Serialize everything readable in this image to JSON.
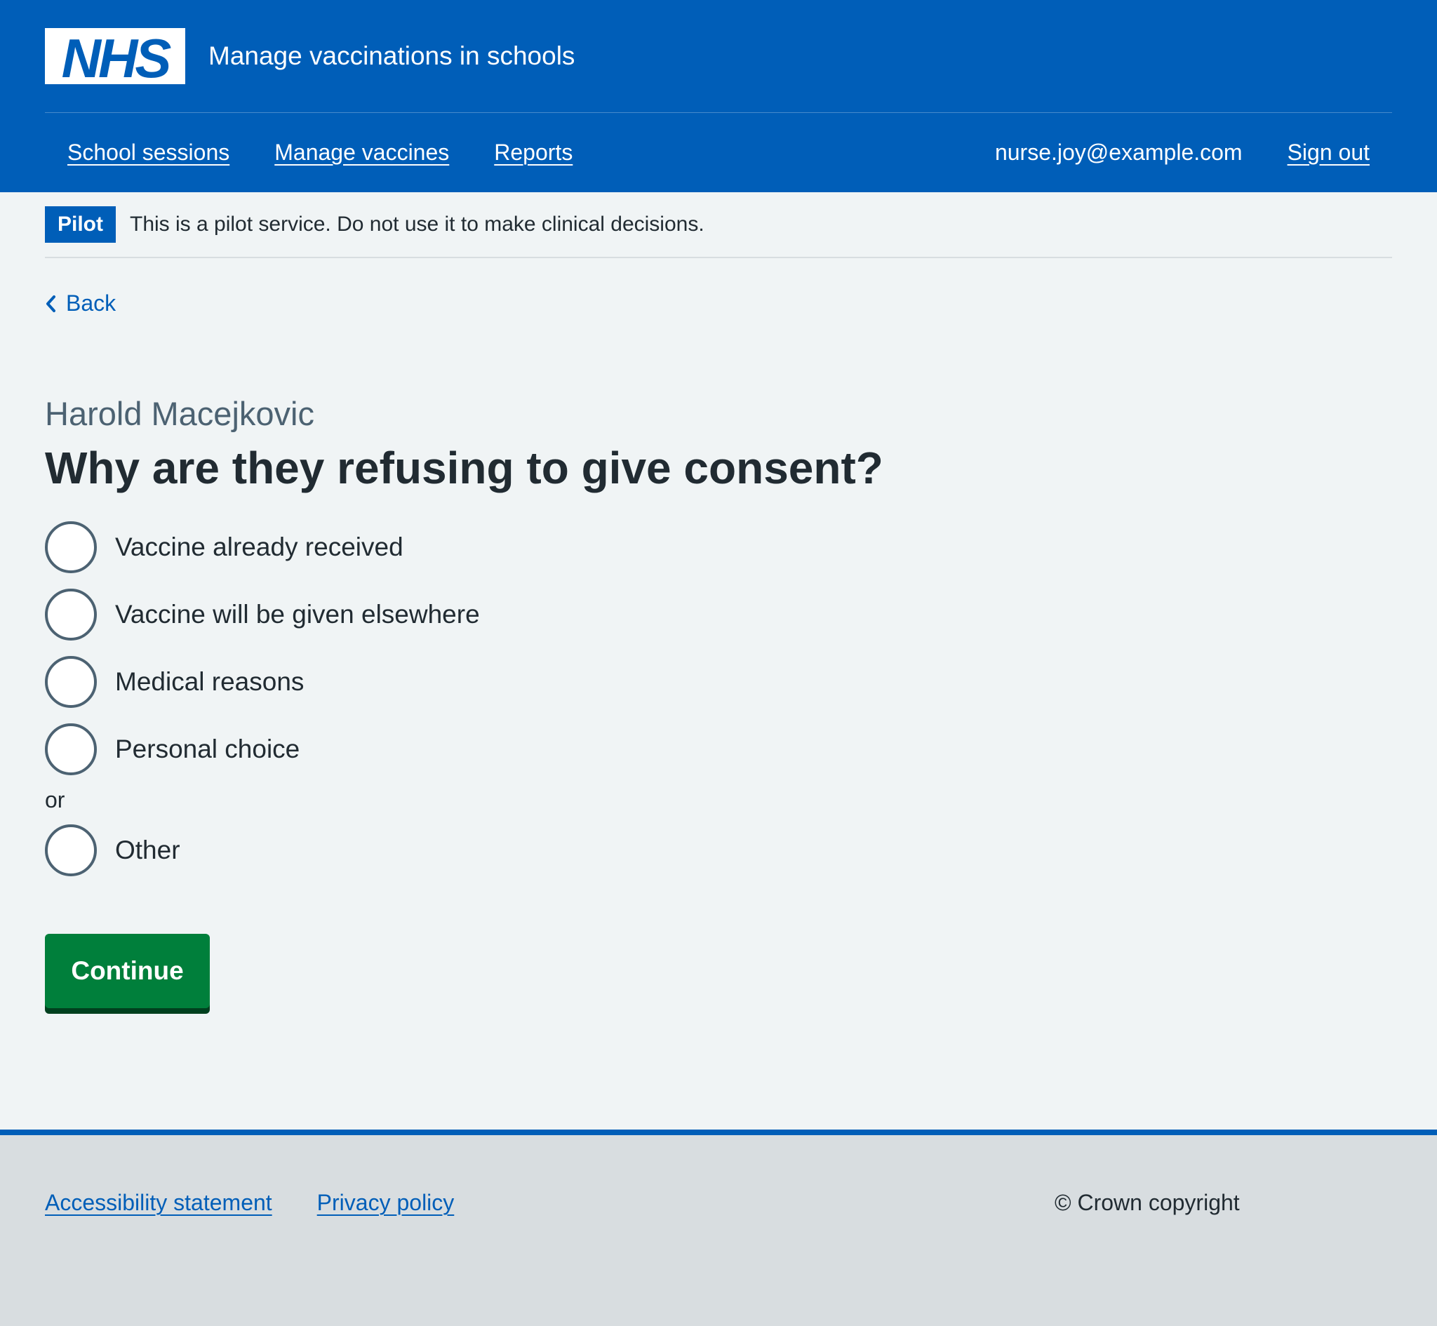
{
  "header": {
    "logo_text": "NHS",
    "service_name": "Manage vaccinations in schools",
    "nav": {
      "links": [
        "School sessions",
        "Manage vaccines",
        "Reports"
      ],
      "user_email": "nurse.joy@example.com",
      "sign_out": "Sign out"
    }
  },
  "pilot_banner": {
    "tag": "Pilot",
    "text": "This is a pilot service. Do not use it to make clinical decisions."
  },
  "back_link": "Back",
  "form": {
    "caption": "Harold Macejkovic",
    "question": "Why are they refusing to give consent?",
    "options": [
      {
        "label": "Vaccine already received",
        "selected": false
      },
      {
        "label": "Vaccine will be given elsewhere",
        "selected": false
      },
      {
        "label": "Medical reasons",
        "selected": false
      },
      {
        "label": "Personal choice",
        "selected": false
      }
    ],
    "divider": "or",
    "other_option": {
      "label": "Other",
      "selected": false
    },
    "continue_label": "Continue"
  },
  "footer": {
    "links": [
      "Accessibility statement",
      "Privacy policy"
    ],
    "copyright": "© Crown copyright"
  },
  "colors": {
    "nhs_blue": "#005eb8",
    "page_background": "#f0f4f5",
    "button_green": "#007f3b",
    "footer_background": "#d8dde0"
  }
}
